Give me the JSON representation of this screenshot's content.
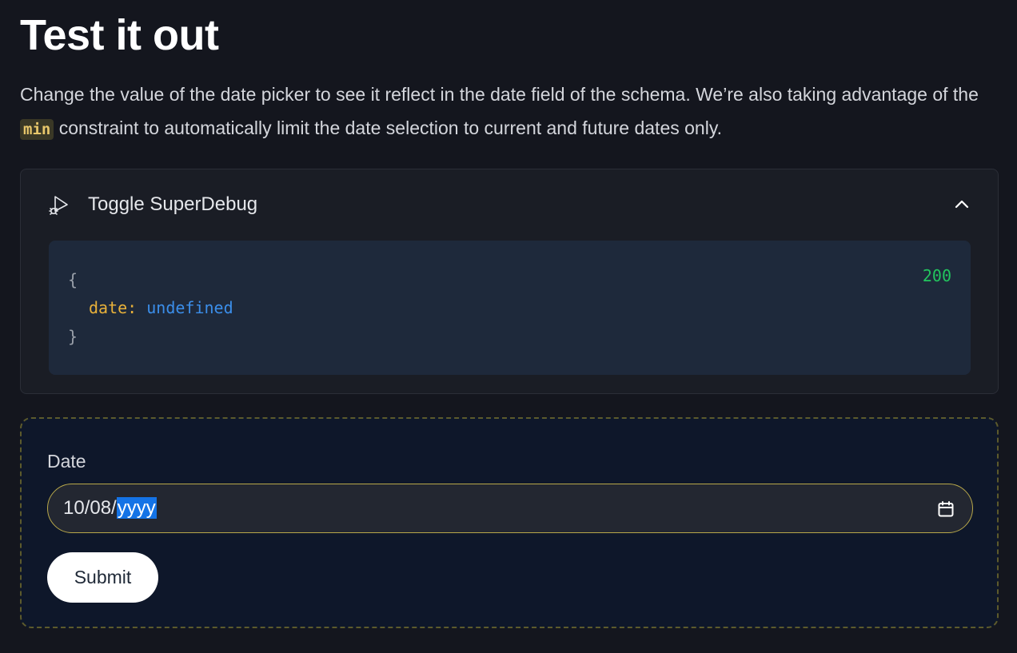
{
  "heading": {
    "title": "Test it out"
  },
  "intro": {
    "text_before": "Change the value of the date picker to see it reflect in the date field of the schema. We’re also taking advantage of the ",
    "code": "min",
    "text_after": " constraint to automatically limit the date selection to current and future dates only."
  },
  "debug": {
    "toggle_label": "Toggle SuperDebug",
    "status": "200",
    "open_brace": "{",
    "key": "date:",
    "value": "undefined",
    "close_brace": "}",
    "bug_icon": "bug-play-icon",
    "chevron_icon": "chevron-up-icon"
  },
  "form": {
    "date_label": "Date",
    "date_value_prefix": "10/08/",
    "date_value_selected": "yyyy",
    "calendar_icon": "calendar-icon",
    "submit_label": "Submit"
  },
  "colors": {
    "background": "#14161e",
    "code_key": "#e8b13a",
    "code_value": "#3b8eea",
    "status_ok": "#22c55e",
    "selection": "#1473e6",
    "input_border": "#b8a84a"
  }
}
